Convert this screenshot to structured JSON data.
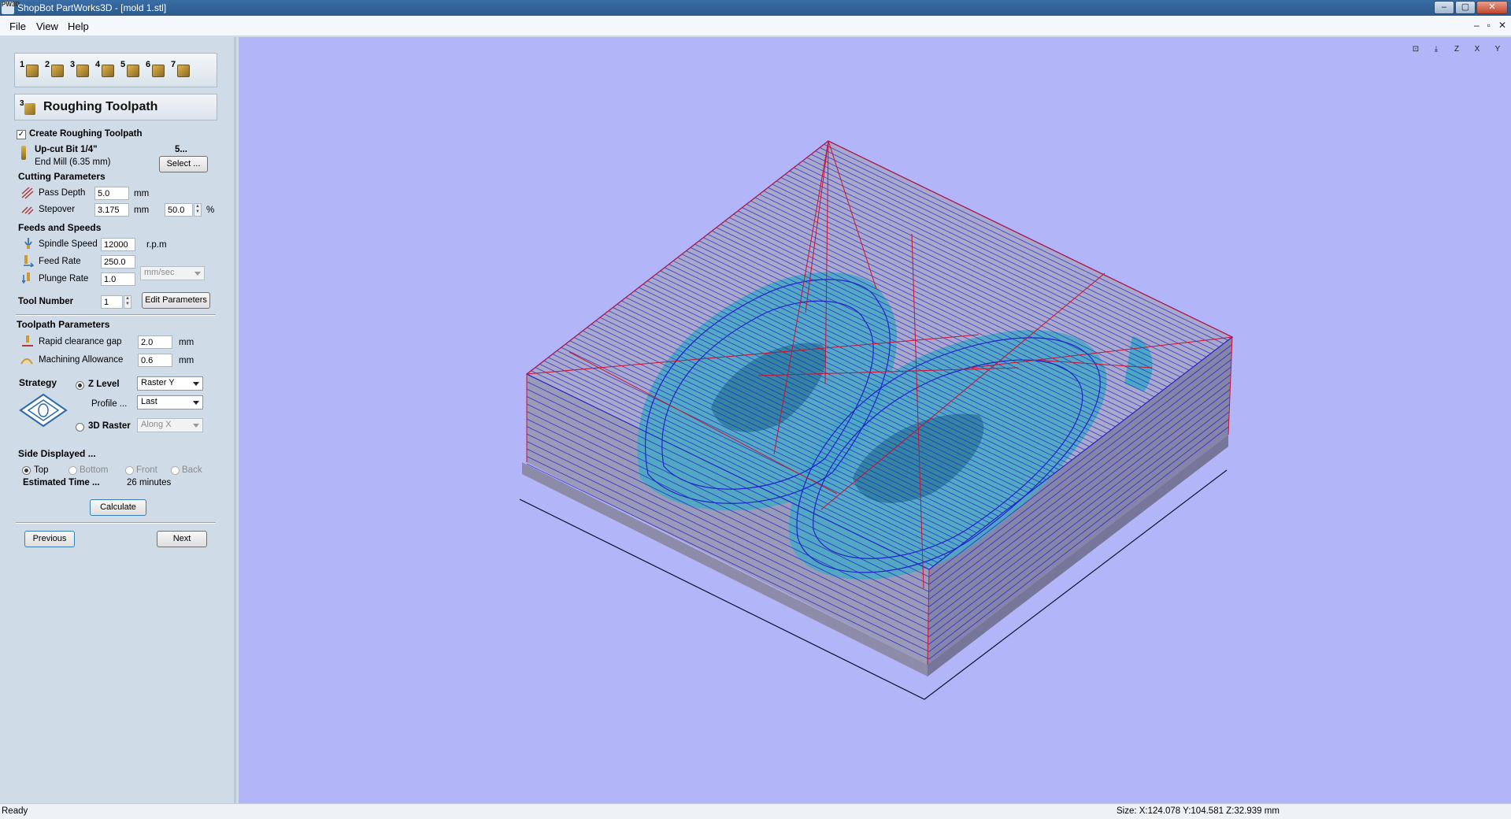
{
  "window": {
    "app_icon_text": "PW3D",
    "title": "ShopBot PartWorks3D - [mold 1.stl]",
    "minimize": "–",
    "maximize": "▢",
    "close": "✕"
  },
  "menu": {
    "file": "File",
    "view": "View",
    "help": "Help"
  },
  "mdi": {
    "minimize": "–",
    "restore": "▫",
    "close": "✕"
  },
  "toolbar": {
    "steps": [
      "1",
      "2",
      "3",
      "4",
      "5",
      "6",
      "7"
    ]
  },
  "panel": {
    "heading": "Roughing Toolpath",
    "heading_num": "3",
    "create_checkbox": {
      "label": "Create Roughing Toolpath",
      "checked": "✓"
    },
    "tool": {
      "name": "Up-cut Bit 1/4\"",
      "desc": "End Mill (6.35 mm)",
      "number_label": "5...",
      "select_label": "Select ..."
    },
    "cutting": {
      "title": "Cutting Parameters",
      "pass_depth": {
        "label": "Pass Depth",
        "value": "5.0",
        "unit": "mm"
      },
      "stepover": {
        "label": "Stepover",
        "value": "3.175",
        "unit": "mm",
        "percent": "50.0",
        "percent_unit": "%"
      }
    },
    "feeds": {
      "title": "Feeds and Speeds",
      "spindle": {
        "label": "Spindle Speed",
        "value": "12000",
        "unit": "r.p.m"
      },
      "feed": {
        "label": "Feed Rate",
        "value": "250.0"
      },
      "plunge": {
        "label": "Plunge Rate",
        "value": "1.0"
      },
      "rate_units": "mm/sec",
      "tool_number": {
        "label": "Tool Number",
        "value": "1"
      },
      "edit_label": "Edit Parameters"
    },
    "toolpath": {
      "title": "Toolpath Parameters",
      "rapid": {
        "label": "Rapid clearance gap",
        "value": "2.0",
        "unit": "mm"
      },
      "allowance": {
        "label": "Machining Allowance",
        "value": "0.6",
        "unit": "mm"
      }
    },
    "strategy": {
      "title": "Strategy",
      "zlevel": "Z Level",
      "zlevel_option": "Raster Y",
      "profile_label": "Profile ...",
      "profile_option": "Last",
      "raster": "3D Raster",
      "raster_option": "Along X"
    },
    "side": {
      "title": "Side Displayed ...",
      "options": [
        "Top",
        "Bottom",
        "Front",
        "Back"
      ],
      "estimated_label": "Estimated Time ...",
      "estimated_value": "26 minutes"
    },
    "calculate": "Calculate",
    "previous": "Previous",
    "next": "Next"
  },
  "view_tools": [
    "⊡",
    "⤓",
    "Z",
    "X",
    "Y"
  ],
  "colors": {
    "background": "#b3b5f9",
    "toolpath": "#2222cc",
    "rapid": "#cc1133",
    "model": "#4aa8c4",
    "block": "#8c8ca8"
  },
  "status": {
    "left": "Ready",
    "right": "Size: X:124.078 Y:104.581 Z:32.939 mm"
  }
}
